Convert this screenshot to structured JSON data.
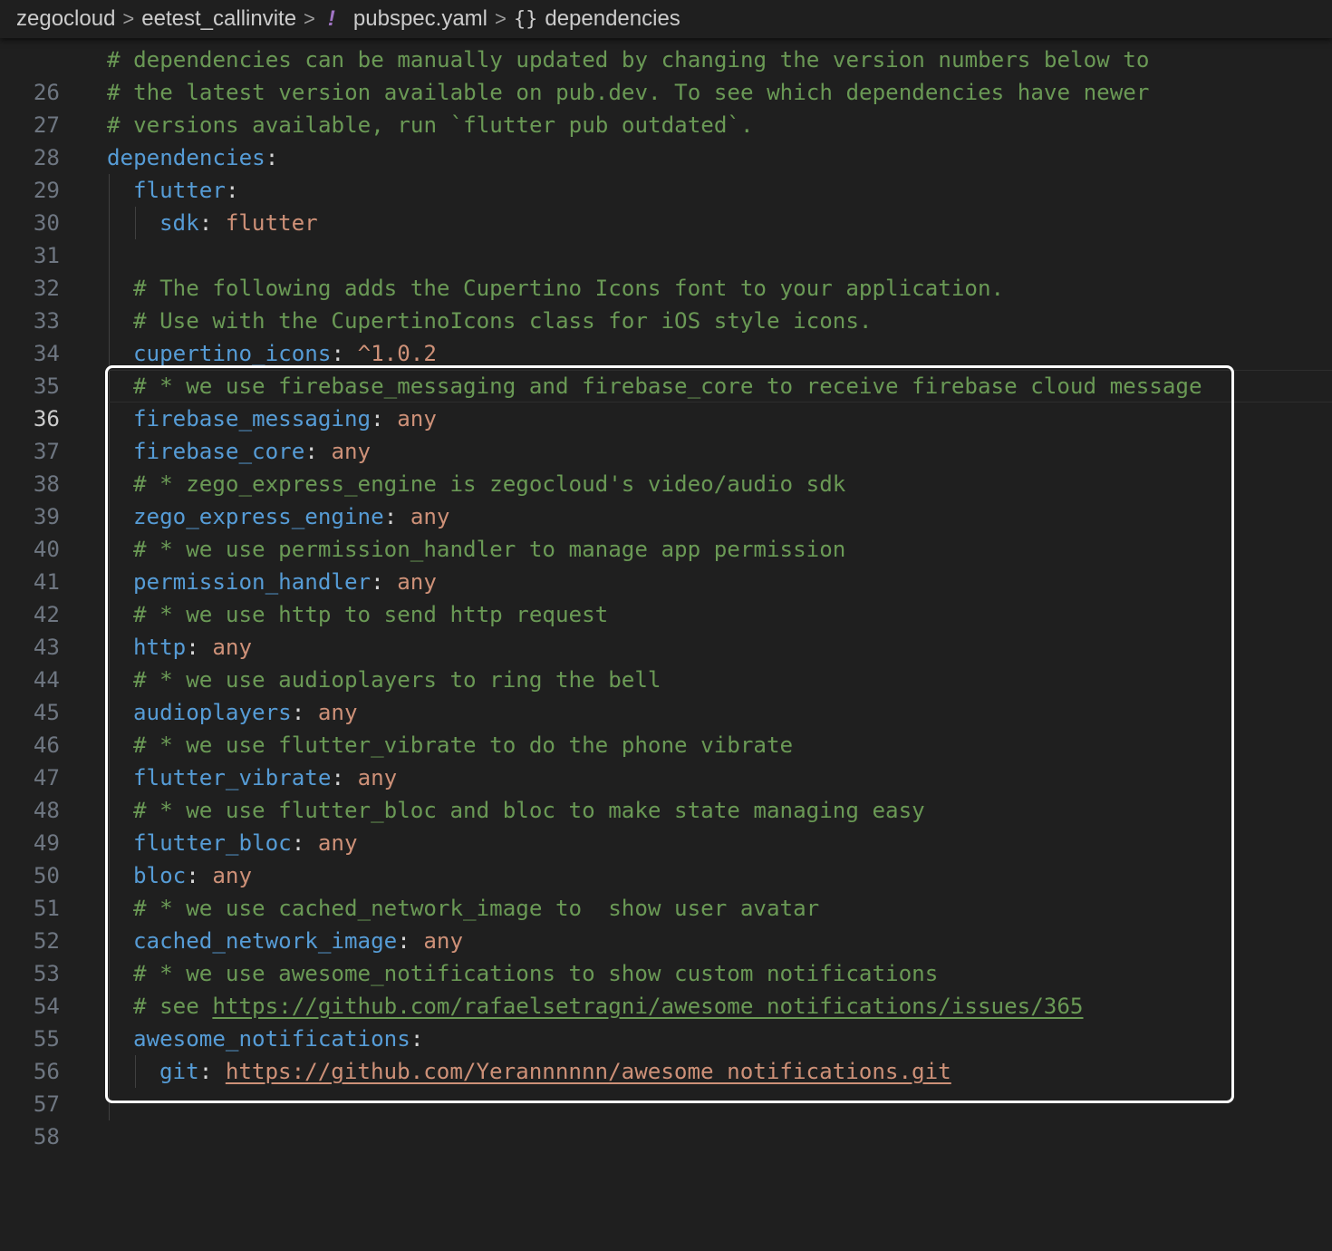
{
  "breadcrumb": {
    "items": [
      "zegocloud",
      "eetest_callinvite"
    ],
    "separator": ">",
    "file_icon": "!",
    "file": "pubspec.yaml",
    "symbol_icon": "{}",
    "symbol": "dependencies"
  },
  "colors": {
    "background": "#1f1f1f",
    "comment": "#6a9955",
    "key": "#569cd6",
    "string_value": "#ce9178",
    "punctuation": "#d4d4d4",
    "line_number": "#6e7681",
    "highlight_box": "#ffffff"
  },
  "editor": {
    "active_line": 36,
    "lines": [
      {
        "n": "26",
        "comment": "# dependencies can be manually updated by changing the version numbers below to"
      },
      {
        "n": "27",
        "comment": "# the latest version available on pub.dev. To see which dependencies have newer"
      },
      {
        "n": "28",
        "comment": "# versions available, run `flutter pub outdated`."
      },
      {
        "n": "29",
        "key": "dependencies",
        "colon": ":"
      },
      {
        "n": "30",
        "key": "flutter",
        "colon": ":"
      },
      {
        "n": "31",
        "key": "sdk",
        "colon": ": ",
        "value": "flutter"
      },
      {
        "n": "32"
      },
      {
        "n": "33",
        "comment": "# The following adds the Cupertino Icons font to your application."
      },
      {
        "n": "34",
        "comment": "# Use with the CupertinoIcons class for iOS style icons."
      },
      {
        "n": "35",
        "key": "cupertino_icons",
        "colon": ": ",
        "value": "^1.0.2"
      },
      {
        "n": "36",
        "comment": "# * we use firebase_messaging and firebase_core to receive firebase cloud message"
      },
      {
        "n": "37",
        "key": "firebase_messaging",
        "colon": ": ",
        "value": "any"
      },
      {
        "n": "38",
        "key": "firebase_core",
        "colon": ": ",
        "value": "any"
      },
      {
        "n": "39",
        "comment": "# * zego_express_engine is zegocloud's video/audio sdk"
      },
      {
        "n": "40",
        "key": "zego_express_engine",
        "colon": ": ",
        "value": "any"
      },
      {
        "n": "41",
        "comment": "# * we use permission_handler to manage app permission"
      },
      {
        "n": "42",
        "key": "permission_handler",
        "colon": ": ",
        "value": "any"
      },
      {
        "n": "43",
        "comment": "# * we use http to send http request"
      },
      {
        "n": "44",
        "key": "http",
        "colon": ": ",
        "value": "any"
      },
      {
        "n": "45",
        "comment": "# * we use audioplayers to ring the bell"
      },
      {
        "n": "46",
        "key": "audioplayers",
        "colon": ": ",
        "value": "any"
      },
      {
        "n": "47",
        "comment": "# * we use flutter_vibrate to do the phone vibrate"
      },
      {
        "n": "48",
        "key": "flutter_vibrate",
        "colon": ": ",
        "value": "any"
      },
      {
        "n": "49",
        "comment": "# * we use flutter_bloc and bloc to make state managing easy"
      },
      {
        "n": "50",
        "key": "flutter_bloc",
        "colon": ": ",
        "value": "any"
      },
      {
        "n": "51",
        "key": "bloc",
        "colon": ": ",
        "value": "any"
      },
      {
        "n": "52",
        "comment": "# * we use cached_network_image to  show user avatar"
      },
      {
        "n": "53",
        "key": "cached_network_image",
        "colon": ": ",
        "value": "any"
      },
      {
        "n": "54",
        "comment": "# * we use awesome_notifications to show custom notifications"
      },
      {
        "n": "55",
        "comment_prefix": "# see ",
        "comment_link": "https://github.com/rafaelsetragni/awesome_notifications/issues/365"
      },
      {
        "n": "56",
        "key": "awesome_notifications",
        "colon": ":"
      },
      {
        "n": "57",
        "key": "git",
        "colon": ": ",
        "value_link": "https://github.com/Yerannnnnn/awesome_notifications.git"
      },
      {
        "n": "58"
      }
    ]
  }
}
